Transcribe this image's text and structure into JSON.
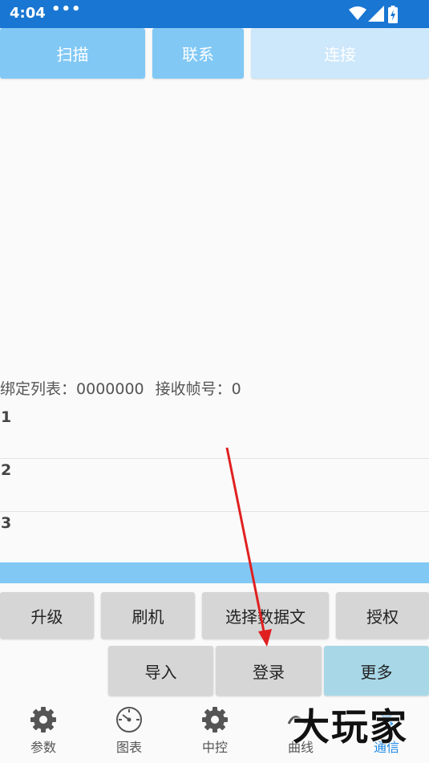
{
  "status_bar": {
    "time": "4:04",
    "more": "•••",
    "icons": [
      "wifi-icon",
      "cell-signal-icon",
      "battery-charging-icon"
    ]
  },
  "top_buttons": {
    "scan": "扫描",
    "contact": "联系",
    "connect": "连接"
  },
  "bind_info": {
    "list_label": "绑定列表：",
    "list_value": "0000000",
    "frame_label": "接收帧号：",
    "frame_value": "0"
  },
  "rows": [
    {
      "num": "1"
    },
    {
      "num": "2"
    },
    {
      "num": "3"
    }
  ],
  "action_buttons": {
    "upgrade": "升级",
    "flash": "刷机",
    "select_data": "选择数据文",
    "authorize": "授权",
    "import": "导入",
    "login": "登录",
    "more": "更多"
  },
  "bottom_nav": [
    {
      "label": "参数",
      "icon": "gear-icon"
    },
    {
      "label": "图表",
      "icon": "gauge-icon"
    },
    {
      "label": "中控",
      "icon": "gear-icon"
    },
    {
      "label": "曲线",
      "icon": "curve-icon"
    },
    {
      "label": "通信",
      "icon": "bluetooth-icon",
      "active": true
    }
  ],
  "watermark": "大玩家",
  "colors": {
    "status_bar": "#1976d2",
    "button_light_blue": "#81c8f5",
    "button_disabled": "#cde7fb",
    "button_gray": "#d6d6d6",
    "button_more": "#a8d8e8",
    "nav_active": "#1e88e5",
    "annotation_arrow": "#e02020"
  }
}
